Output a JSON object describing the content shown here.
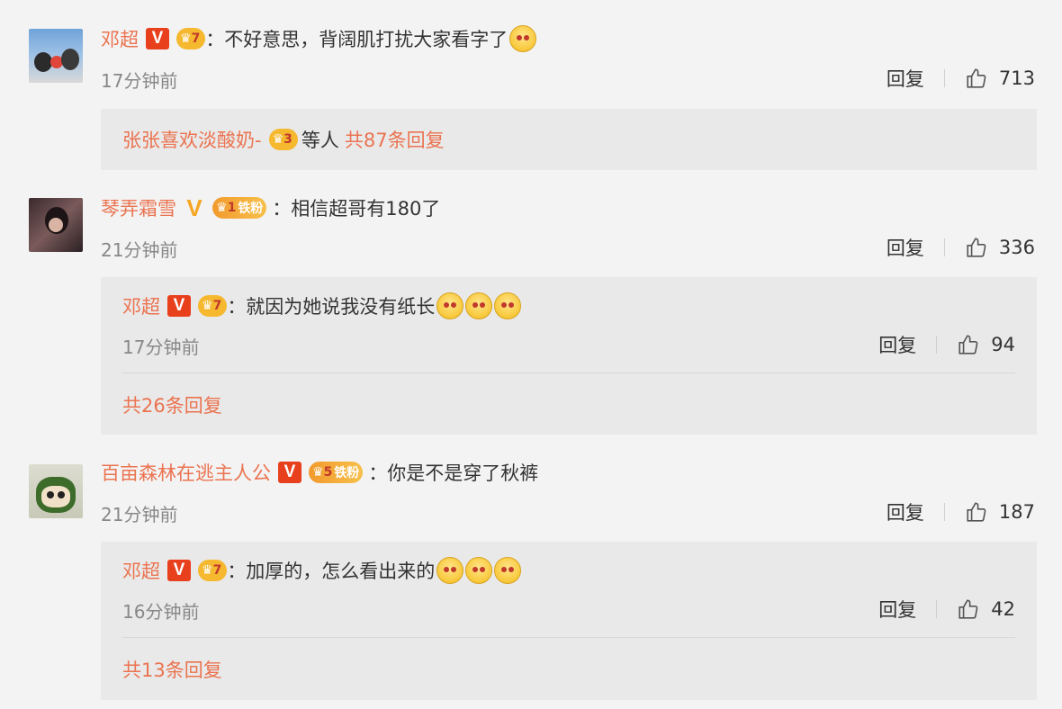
{
  "comments": [
    {
      "user": "邓超",
      "text": "：不好意思，背阔肌打扰大家看字了",
      "time": "17分钟前",
      "reply_label": "回复",
      "likes": "713",
      "crown_level": "7",
      "subreply": {
        "user": "张张喜欢淡酸奶-",
        "crown_level": "3",
        "middle": "等人",
        "count_text": "共87条回复"
      }
    },
    {
      "user": "琴弄霜雪",
      "text": "：相信超哥有180了",
      "time": "21分钟前",
      "reply_label": "回复",
      "likes": "336",
      "crown_level": "1",
      "crown_fan": "铁粉",
      "reply": {
        "user": "邓超",
        "crown_level": "7",
        "text": "：就因为她说我没有纸长",
        "time": "17分钟前",
        "reply_label": "回复",
        "likes": "94",
        "more": "共26条回复"
      }
    },
    {
      "user": "百亩森林在逃主人公",
      "text": "：你是不是穿了秋裤",
      "time": "21分钟前",
      "reply_label": "回复",
      "likes": "187",
      "crown_level": "5",
      "crown_fan": "铁粉",
      "reply": {
        "user": "邓超",
        "crown_level": "7",
        "text": "：加厚的，怎么看出来的",
        "time": "16分钟前",
        "reply_label": "回复",
        "likes": "42",
        "more": "共13条回复"
      }
    }
  ],
  "badges": {
    "v": "V"
  },
  "icons": {
    "like": "thumbs-up-icon",
    "emoji": "emoji-icon",
    "crown": "crown-icon"
  },
  "colors": {
    "username": "#eb7350",
    "vbadge": "#e8401c",
    "crown": "#f5b82e"
  }
}
